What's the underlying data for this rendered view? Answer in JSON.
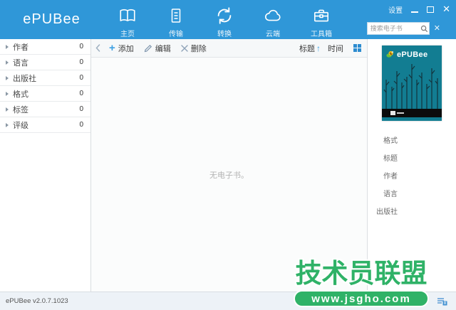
{
  "header": {
    "logo": "ePUBee",
    "nav": [
      {
        "label": "主页",
        "icon": "book-icon"
      },
      {
        "label": "传输",
        "icon": "document-icon"
      },
      {
        "label": "转换",
        "icon": "refresh-icon"
      },
      {
        "label": "云端",
        "icon": "cloud-icon"
      },
      {
        "label": "工具箱",
        "icon": "toolbox-icon"
      }
    ],
    "settings_label": "设置",
    "search": {
      "placeholder": "搜索电子书",
      "value": ""
    }
  },
  "sidebar": {
    "items": [
      {
        "label": "作者",
        "count": "0"
      },
      {
        "label": "语言",
        "count": "0"
      },
      {
        "label": "出版社",
        "count": "0"
      },
      {
        "label": "格式",
        "count": "0"
      },
      {
        "label": "标签",
        "count": "0"
      },
      {
        "label": "评级",
        "count": "0"
      }
    ]
  },
  "toolbar": {
    "add_label": "添加",
    "edit_label": "编辑",
    "delete_label": "删除",
    "sort_title_label": "标题",
    "sort_time_label": "时间"
  },
  "main": {
    "empty_text": "无电子书。"
  },
  "right_panel": {
    "cover_title": "ePUBee",
    "fields": [
      "格式",
      "标题",
      "作者",
      "语言",
      "出版社"
    ]
  },
  "statusbar": {
    "version": "ePUBee v2.0.7.1023"
  },
  "watermark": {
    "title": "技术员联盟",
    "url": "www.jsgho.com"
  },
  "colors": {
    "header_blue": "#2f97d8",
    "accent_blue": "#3da0e3",
    "watermark_green": "#2fb267",
    "cover_teal": "#127d92"
  }
}
